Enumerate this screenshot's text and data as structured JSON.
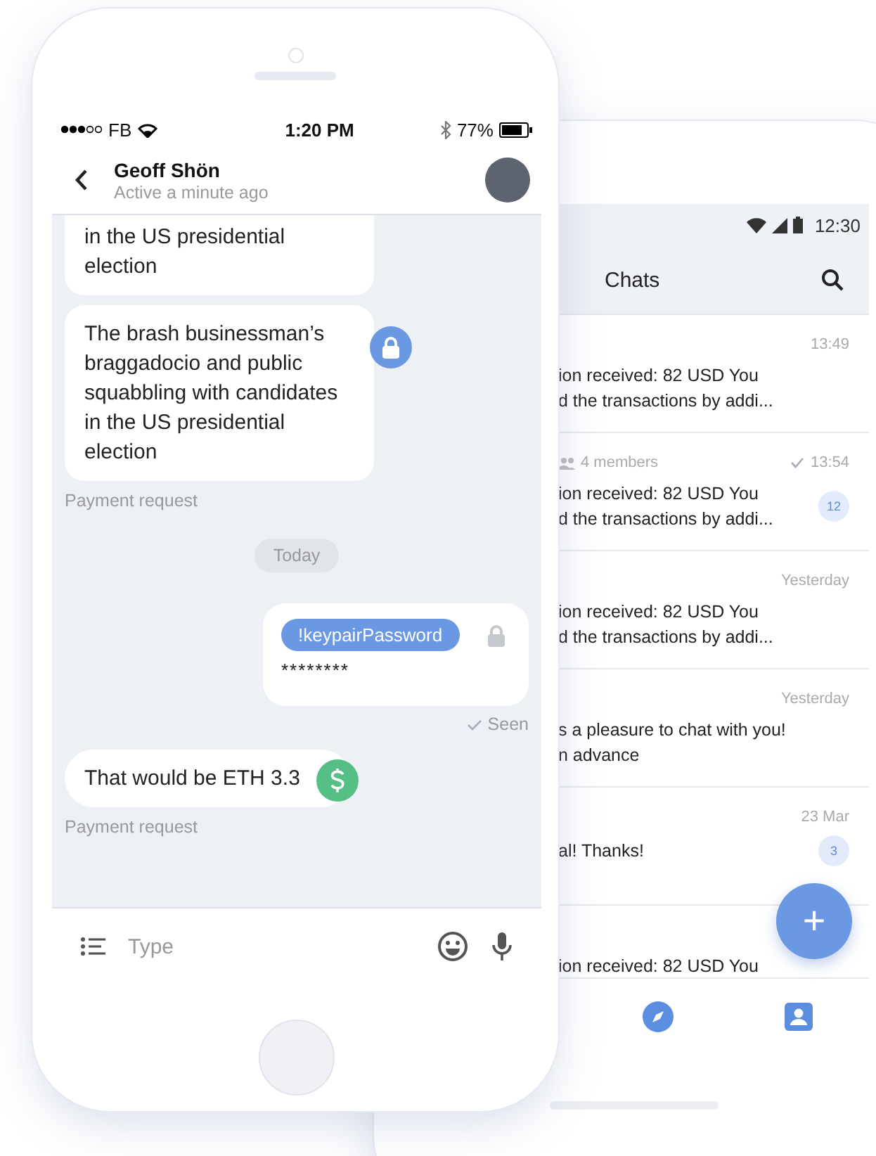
{
  "chat_phone": {
    "status_bar": {
      "carrier": "FB",
      "time": "1:20 PM",
      "battery": "77%"
    },
    "header": {
      "name": "Geoff Shön",
      "status": "Active a minute ago"
    },
    "messages": [
      {
        "kind": "text",
        "text": "in the US presidential election"
      },
      {
        "kind": "secure_text",
        "text": "The brash businessman’s braggadocio and public squabbling with candidates in the US presidential election"
      },
      {
        "kind": "caption",
        "text": "Payment request"
      },
      {
        "kind": "date",
        "text": "Today"
      },
      {
        "kind": "password",
        "tag": "!keypairPassword",
        "value": "********"
      },
      {
        "kind": "receipt",
        "text": "Seen"
      },
      {
        "kind": "payment_text",
        "text": "That would be ETH 3.3"
      },
      {
        "kind": "caption",
        "text": "Payment request"
      }
    ],
    "composer": {
      "placeholder": "Type"
    }
  },
  "chats_phone": {
    "status_bar": {
      "time": "12:30"
    },
    "title": "Chats",
    "chats": [
      {
        "read": false,
        "time": "13:49",
        "lines": [
          "ion received: 82 USD You",
          "d the transactions by addi..."
        ]
      },
      {
        "members": "4 members",
        "read": true,
        "time": "13:54",
        "lines": [
          "ion received: 82 USD You",
          "d the transactions by addi..."
        ],
        "unread": "12"
      },
      {
        "read": false,
        "time": "Yesterday",
        "lines": [
          "ion received: 82 USD You",
          "d the transactions by addi..."
        ]
      },
      {
        "read": false,
        "time": "Yesterday",
        "lines": [
          "s a pleasure to chat with you!",
          "n advance"
        ]
      },
      {
        "read": false,
        "time": "23 Mar",
        "lines": [
          "al! Thanks!"
        ],
        "unread": "3"
      },
      {
        "lines": [
          "ion received: 82 USD You"
        ]
      }
    ],
    "fab": "+"
  }
}
